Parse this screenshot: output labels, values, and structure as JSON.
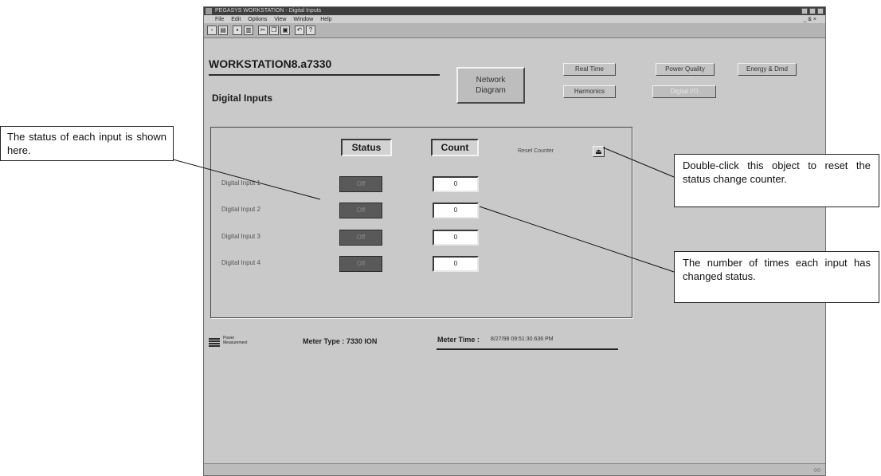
{
  "window": {
    "title": "PEGASYS WORKSTATION - Digital Inputs",
    "menu": [
      "File",
      "Edit",
      "Options",
      "View",
      "Window",
      "Help"
    ],
    "menu_right": "_ & ×",
    "toolbar_icons": [
      "new-icon",
      "open-icon",
      "save-icon",
      "print-icon",
      "cut-icon",
      "copy-icon",
      "paste-icon",
      "undo-icon",
      "help-icon"
    ]
  },
  "header": {
    "workstation": "WORKSTATION8.a7330",
    "page_title": "Digital Inputs"
  },
  "nav": {
    "network_diagram": [
      "Network",
      "Diagram"
    ],
    "real_time": "Real Time",
    "power_quality": "Power Quality",
    "energy_demand": "Energy & Dmd",
    "harmonics": "Harmonics",
    "disabled": "Digital I/O"
  },
  "panel": {
    "status_header": "Status",
    "count_header": "Count",
    "reset_label": "Reset Counter",
    "reset_button": "⏏",
    "inputs": [
      {
        "label": "Digital Input 1",
        "status": "Off",
        "count": "0"
      },
      {
        "label": "Digital Input 2",
        "status": "Off",
        "count": "0"
      },
      {
        "label": "Digital Input 3",
        "status": "Off",
        "count": "0"
      },
      {
        "label": "Digital Input 4",
        "status": "Off",
        "count": "0"
      }
    ]
  },
  "footer": {
    "logo_text": [
      "Power",
      "Measurement"
    ],
    "meter_type": "Meter Type : 7330 ION",
    "meter_time_label": "Meter Time :",
    "meter_time_value": "8/27/98 09:51:30.636 PM"
  },
  "callouts": {
    "status": "The status of each input is shown here.",
    "reset": "Double-click this object to reset the status change counter.",
    "count": "The number of times each input has changed status."
  },
  "colors": {
    "window_bg": "#c9c9c9",
    "status_off": "#595959",
    "count_bg": "#ffffff"
  }
}
